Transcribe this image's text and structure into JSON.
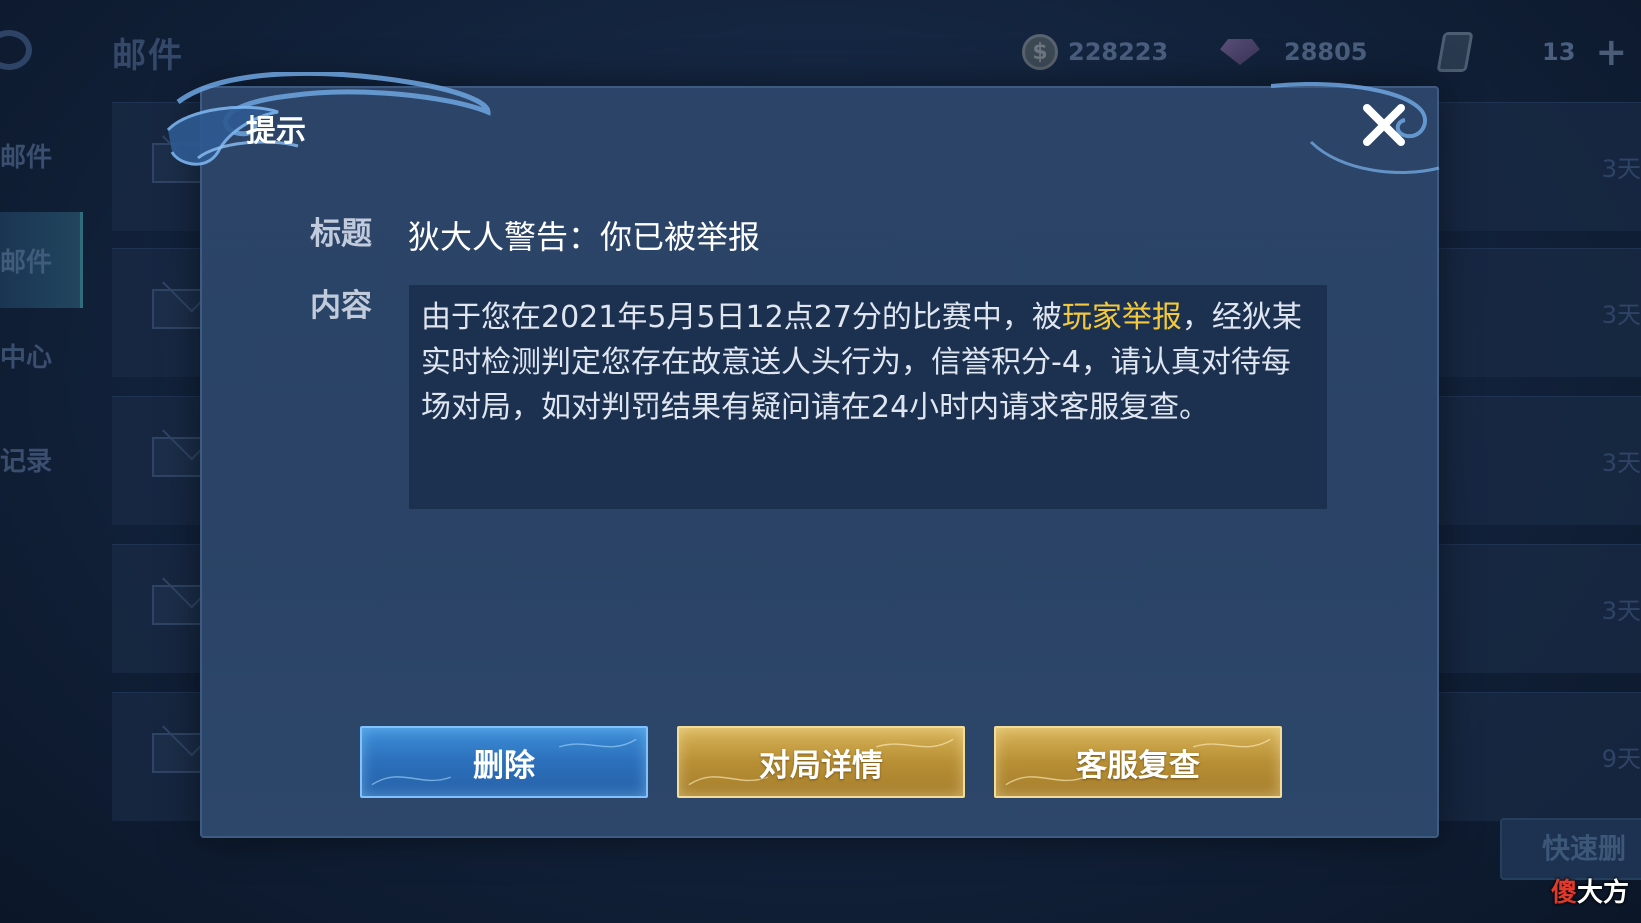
{
  "topbar": {
    "page_title": "邮件",
    "gold_amount": "228223",
    "diamond_amount": "28805",
    "ticket_amount": "13",
    "icons": [
      "back-icon",
      "gold-coin-icon",
      "diamond-icon",
      "card-icon",
      "plus-icon"
    ]
  },
  "sidenav": {
    "items": [
      {
        "label": "邮件"
      },
      {
        "label": "邮件"
      },
      {
        "label": "中心"
      },
      {
        "label": "记录"
      }
    ]
  },
  "mail_list": {
    "rows": [
      {
        "days": "3天"
      },
      {
        "days": "3天"
      },
      {
        "days": "3天"
      },
      {
        "days": "3天"
      },
      {
        "days": "9天"
      }
    ],
    "quick_delete_label": "快速删"
  },
  "dialog": {
    "title": "提示",
    "subject_label": "标题",
    "subject_value": "狄大人警告：你已被举报",
    "content_label": "内容",
    "content_before": "由于您在2021年5月5日12点27分的比赛中，被",
    "content_highlight": "玩家举报",
    "content_after": "，经狄某实时检测判定您存在故意送人头行为，信誉积分-4，请认真对待每场对局，如对判罚结果有疑问请在24小时内请求客服复查。",
    "highlight_color": "#f3c93a",
    "buttons": {
      "delete": "删除",
      "match_details": "对局详情",
      "support_review": "客服复查"
    }
  },
  "watermark": {
    "first_char": "傻",
    "rest": "大方"
  }
}
